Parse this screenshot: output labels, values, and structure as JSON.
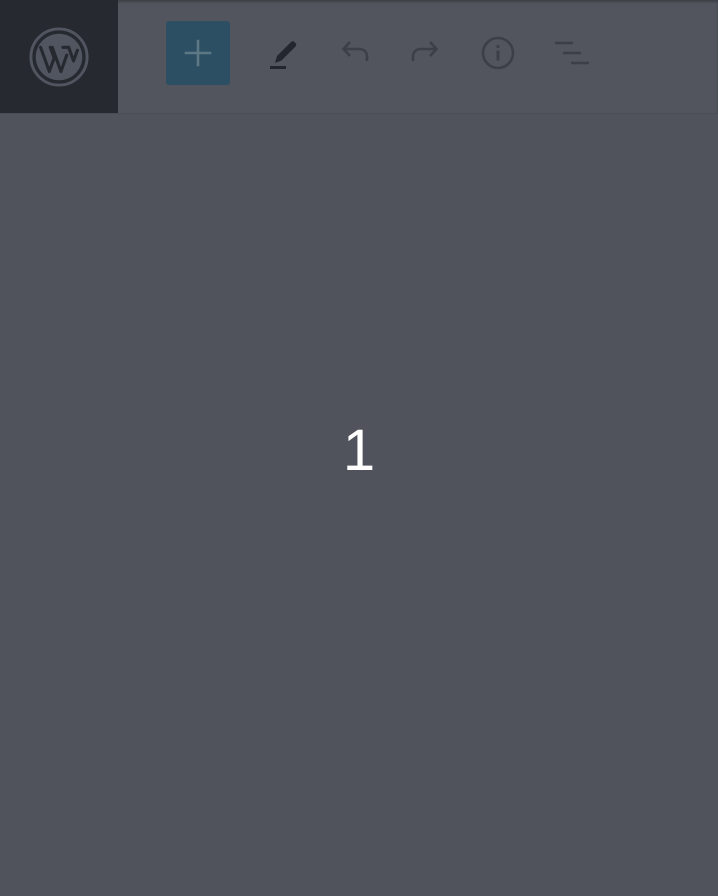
{
  "header": {
    "logo_icon": "wordpress-icon",
    "toolbar": [
      {
        "icon": "plus-icon",
        "name": "add-block-button"
      },
      {
        "icon": "pencil-icon",
        "name": "tools-button"
      },
      {
        "icon": "undo-icon",
        "name": "undo-button"
      },
      {
        "icon": "redo-icon",
        "name": "redo-button"
      },
      {
        "icon": "info-icon",
        "name": "details-button"
      },
      {
        "icon": "list-view-icon",
        "name": "list-view-button"
      }
    ]
  },
  "overlay": {
    "label": "1"
  },
  "colors": {
    "background": "#50535c",
    "logo_background": "#262930",
    "add_button_background": "#2d4f63",
    "icon_muted": "#3c3f46",
    "icon_dark": "#23262d",
    "overlay_text": "#ffffff"
  }
}
